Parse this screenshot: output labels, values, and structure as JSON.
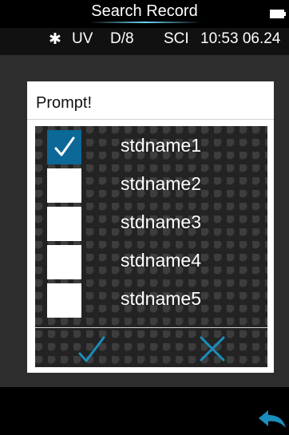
{
  "header": {
    "title": "Search Record"
  },
  "status": {
    "bluetooth_icon": "bluetooth-icon",
    "mode": "UV",
    "geometry": "D/8",
    "spec": "SCI",
    "time": "10:53 06.24"
  },
  "dialog": {
    "title": "Prompt!",
    "items": [
      {
        "label": "stdname1",
        "checked": true
      },
      {
        "label": "stdname2",
        "checked": false
      },
      {
        "label": "stdname3",
        "checked": false
      },
      {
        "label": "stdname4",
        "checked": false
      },
      {
        "label": "stdname5",
        "checked": false
      }
    ],
    "confirm_icon": "checkmark-icon",
    "cancel_icon": "cross-icon"
  },
  "footer": {
    "back_icon": "back-arrow-icon"
  },
  "colors": {
    "accent": "#0b6897",
    "bg": "#000000",
    "panel": "#2d2d2d",
    "icon": "#1b8dbc"
  }
}
